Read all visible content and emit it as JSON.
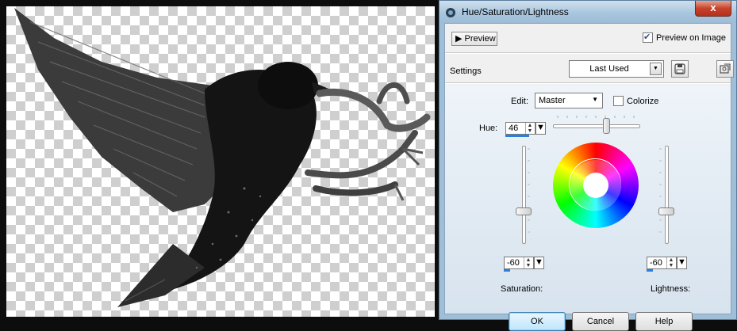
{
  "dialog": {
    "title": "Hue/Saturation/Lightness",
    "close_label": "x"
  },
  "preview": {
    "button_label": "Preview",
    "preview_on_image_label": "Preview on Image",
    "preview_on_image_checked": true
  },
  "settings": {
    "label": "Settings",
    "selected": "Last Used"
  },
  "edit": {
    "label": "Edit:",
    "selected": "Master",
    "colorize_label": "Colorize",
    "colorize_checked": false
  },
  "hue": {
    "label": "Hue:",
    "value": "46"
  },
  "saturation": {
    "label": "Saturation:",
    "value": "-60"
  },
  "lightness": {
    "label": "Lightness:",
    "value": "-60"
  },
  "buttons": {
    "ok": "OK",
    "cancel": "Cancel",
    "help": "Help"
  },
  "icons": {
    "title": "app-icon",
    "save": "save-preset-icon",
    "manage": "manage-presets-icon",
    "wheel": "color-wheel-icon"
  },
  "colors": {
    "accent": "#2b7de0",
    "default_button": "#bee6fd",
    "close_button": "#c7432b"
  }
}
